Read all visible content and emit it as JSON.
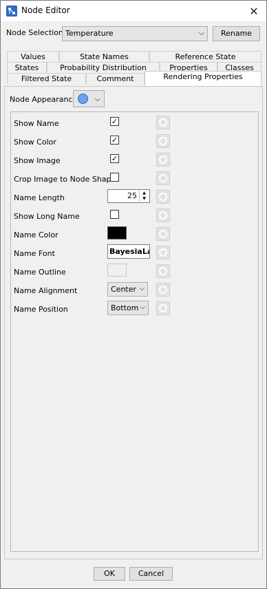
{
  "window": {
    "title": "Node Editor",
    "close_symbol": "✕"
  },
  "node_selection": {
    "label": "Node Selection:",
    "value": "Temperature",
    "rename_label": "Rename"
  },
  "tabs": {
    "row1": [
      "Values",
      "State Names",
      "Reference State"
    ],
    "row2": [
      "States",
      "Probability Distribution",
      "Properties",
      "Classes"
    ],
    "row3": [
      "Filtered State",
      "Comment",
      "Rendering Properties"
    ]
  },
  "appearance": {
    "label": "Node Appearance",
    "color": "#6f9ef6"
  },
  "properties": {
    "show_name": {
      "label": "Show Name",
      "checked": "✓"
    },
    "show_color": {
      "label": "Show Color",
      "checked": "✓"
    },
    "show_image": {
      "label": "Show Image",
      "checked": "✓"
    },
    "crop_image": {
      "label": "Crop Image to Node Shape",
      "checked": ""
    },
    "name_length": {
      "label": "Name Length",
      "value": "25"
    },
    "show_long_name": {
      "label": "Show Long Name",
      "checked": ""
    },
    "name_color": {
      "label": "Name Color",
      "color": "#000000"
    },
    "name_font": {
      "label": "Name Font",
      "value": "BayesiaLab"
    },
    "name_outline": {
      "label": "Name Outline"
    },
    "name_alignment": {
      "label": "Name Alignment",
      "value": "Center"
    },
    "name_position": {
      "label": "Name Position",
      "value": "Bottom"
    }
  },
  "buttons": {
    "ok": "OK",
    "cancel": "Cancel"
  }
}
